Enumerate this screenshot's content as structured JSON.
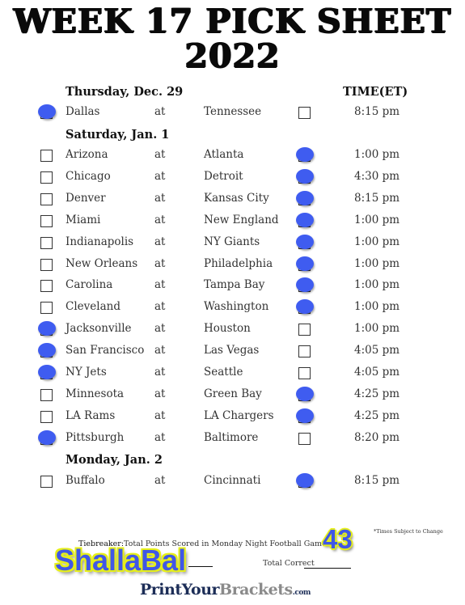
{
  "title": {
    "line1": "WEEK 17 PICK SHEET",
    "line2": "2022"
  },
  "time_header": "TIME(ET)",
  "at_label": "at",
  "sections": [
    {
      "day": "Thursday, Dec. 29",
      "games": [
        {
          "away": "Dallas",
          "home": "Tennessee",
          "time": "8:15 pm",
          "pick": "away"
        }
      ]
    },
    {
      "day": "Saturday, Jan. 1",
      "games": [
        {
          "away": "Arizona",
          "home": "Atlanta",
          "time": "1:00 pm",
          "pick": "home"
        },
        {
          "away": "Chicago",
          "home": "Detroit",
          "time": "4:30 pm",
          "pick": "home"
        },
        {
          "away": "Denver",
          "home": "Kansas City",
          "time": "8:15 pm",
          "pick": "home"
        },
        {
          "away": "Miami",
          "home": "New England",
          "time": "1:00 pm",
          "pick": "home"
        },
        {
          "away": "Indianapolis",
          "home": "NY Giants",
          "time": "1:00 pm",
          "pick": "home"
        },
        {
          "away": "New Orleans",
          "home": "Philadelphia",
          "time": "1:00 pm",
          "pick": "home"
        },
        {
          "away": "Carolina",
          "home": "Tampa Bay",
          "time": "1:00 pm",
          "pick": "home"
        },
        {
          "away": "Cleveland",
          "home": "Washington",
          "time": "1:00 pm",
          "pick": "home"
        },
        {
          "away": "Jacksonville",
          "home": "Houston",
          "time": "1:00 pm",
          "pick": "away"
        },
        {
          "away": "San Francisco",
          "home": "Las Vegas",
          "time": "4:05 pm",
          "pick": "away"
        },
        {
          "away": "NY Jets",
          "home": "Seattle",
          "time": "4:05 pm",
          "pick": "away"
        },
        {
          "away": "Minnesota",
          "home": "Green Bay",
          "time": "4:25 pm",
          "pick": "home"
        },
        {
          "away": "LA Rams",
          "home": "LA Chargers",
          "time": "4:25 pm",
          "pick": "home"
        },
        {
          "away": "Pittsburgh",
          "home": "Baltimore",
          "time": "8:20 pm",
          "pick": "away"
        }
      ]
    },
    {
      "day": "Monday, Jan. 2",
      "games": [
        {
          "away": "Buffalo",
          "home": "Cincinnati",
          "time": "8:15 pm",
          "pick": "home"
        }
      ]
    }
  ],
  "footnote": "*Times Subject to Change",
  "tiebreaker": {
    "label": "Tiebreaker:",
    "text": "Total Points Scored in Monday Night Football Game",
    "value": "43"
  },
  "name": {
    "value": "ShallaBal"
  },
  "total_correct": {
    "label": "Total Correct",
    "value": ""
  },
  "logo": {
    "part1": "PrintYour",
    "part2": "Brackets",
    "part3": ".com"
  },
  "colors": {
    "pick_mark": "#3f5cf0",
    "highlight_outline": "#e6ef1a",
    "logo_navy": "#1c2d57",
    "logo_gray": "#8a8a8a"
  }
}
